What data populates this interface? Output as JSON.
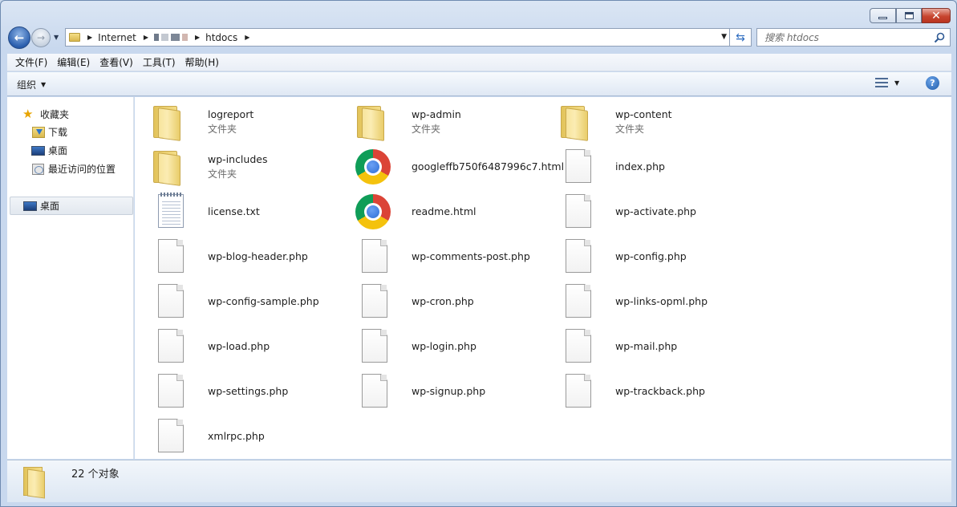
{
  "window": {
    "caption_buttons": {
      "minimize": "minimize",
      "maximize": "maximize",
      "close": "close"
    }
  },
  "address": {
    "crumbs": [
      "Internet",
      "htdocs"
    ],
    "obscured_crumb": true
  },
  "search": {
    "placeholder": "搜索 htdocs"
  },
  "menu": [
    "文件(F)",
    "编辑(E)",
    "查看(V)",
    "工具(T)",
    "帮助(H)"
  ],
  "toolbar": {
    "organize_label": "组织"
  },
  "navpane": {
    "favorites_label": "收藏夹",
    "downloads_label": "下载",
    "desktop_label": "桌面",
    "recent_label": "最近访问的位置",
    "desktop_root_label": "桌面"
  },
  "files": [
    {
      "name": "logreport",
      "sub": "文件夹",
      "icon": "folder-icon"
    },
    {
      "name": "wp-admin",
      "sub": "文件夹",
      "icon": "folder-icon"
    },
    {
      "name": "wp-content",
      "sub": "文件夹",
      "icon": "folder-icon"
    },
    {
      "name": "wp-includes",
      "sub": "文件夹",
      "icon": "folder-icon"
    },
    {
      "name": "googleffb750f6487996c7.html",
      "icon": "chrome-icon"
    },
    {
      "name": "index.php",
      "icon": "file-icon"
    },
    {
      "name": "license.txt",
      "icon": "text-file-icon"
    },
    {
      "name": "readme.html",
      "icon": "chrome-icon"
    },
    {
      "name": "wp-activate.php",
      "icon": "file-icon"
    },
    {
      "name": "wp-blog-header.php",
      "icon": "file-icon"
    },
    {
      "name": "wp-comments-post.php",
      "icon": "file-icon"
    },
    {
      "name": "wp-config.php",
      "icon": "file-icon"
    },
    {
      "name": "wp-config-sample.php",
      "icon": "file-icon"
    },
    {
      "name": "wp-cron.php",
      "icon": "file-icon"
    },
    {
      "name": "wp-links-opml.php",
      "icon": "file-icon"
    },
    {
      "name": "wp-load.php",
      "icon": "file-icon"
    },
    {
      "name": "wp-login.php",
      "icon": "file-icon"
    },
    {
      "name": "wp-mail.php",
      "icon": "file-icon"
    },
    {
      "name": "wp-settings.php",
      "icon": "file-icon"
    },
    {
      "name": "wp-signup.php",
      "icon": "file-icon"
    },
    {
      "name": "wp-trackback.php",
      "icon": "file-icon"
    },
    {
      "name": "xmlrpc.php",
      "icon": "file-icon"
    }
  ],
  "status": {
    "count_text": "22 个对象"
  }
}
